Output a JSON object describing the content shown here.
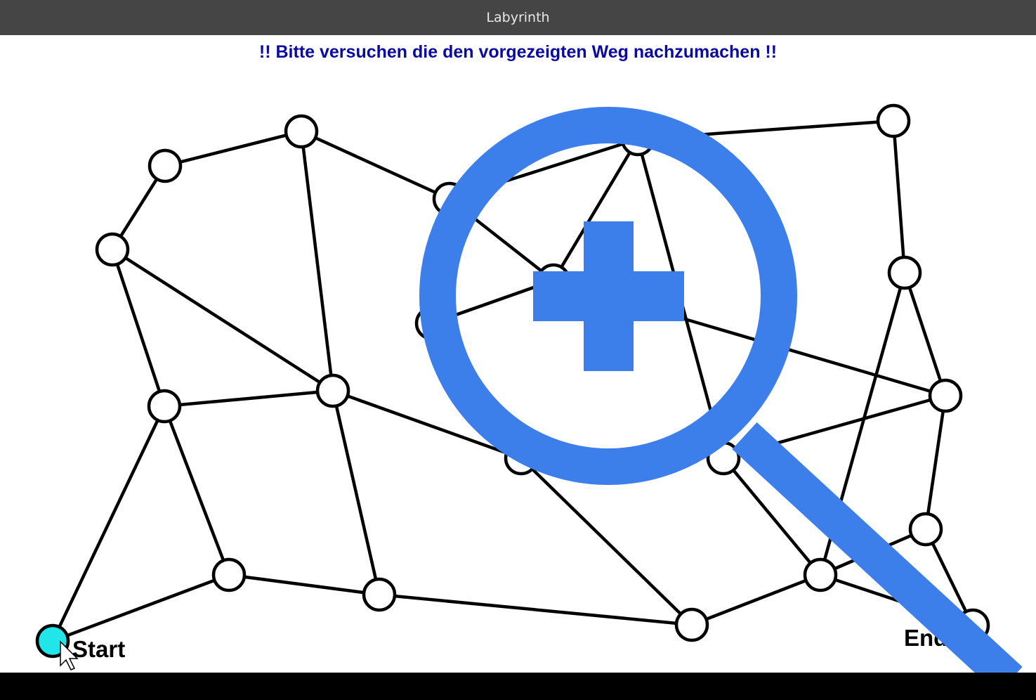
{
  "window": {
    "title": "Labyrinth"
  },
  "instruction": "!! Bitte versuchen die den vorgezeigten Weg nachzumachen !!",
  "labels": {
    "start": "Start",
    "end": "End"
  },
  "colors": {
    "start_node": "#22e5ea",
    "node_fill": "#ffffff",
    "edge": "#000000",
    "instruction": "#0a0aa0",
    "zoom_overlay": "#3d7fea"
  },
  "overlay": {
    "icon": "zoom-in-magnifier-icon"
  },
  "cursor": {
    "icon": "mouse-pointer-icon"
  }
}
